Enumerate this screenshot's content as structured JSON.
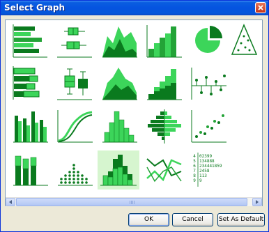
{
  "window": {
    "title": "Select Graph"
  },
  "buttons": {
    "ok": "OK",
    "cancel": "Cancel",
    "set_default": "Set As Default"
  },
  "colors": {
    "dark_green": "#0a7a1e",
    "mid_green": "#23a337",
    "light_green": "#3cd55a",
    "selected_bg": "#d6f5cf",
    "titlebar": "#0553e0"
  },
  "stem_leaf": {
    "rows": [
      {
        "stem": "4",
        "leaves": "02399"
      },
      {
        "stem": "5",
        "leaves": "134888"
      },
      {
        "stem": "6",
        "leaves": "234441859"
      },
      {
        "stem": "7",
        "leaves": "2458"
      },
      {
        "stem": "8",
        "leaves": "113"
      },
      {
        "stem": "9",
        "leaves": "9"
      }
    ]
  },
  "gallery": {
    "selected": "histogram-highlighted",
    "rows": [
      [
        "horizontal-bar",
        "box-plot",
        "area-overlay",
        "step-bars",
        "pie",
        "ternary"
      ],
      [
        "horizontal-bar-grouped",
        "box-plot-pair",
        "area-stacked",
        "step-bars-stacked",
        "dot-line"
      ],
      [
        "grouped-bars",
        "cumulative-curve",
        "histogram",
        "back-to-back-histogram",
        "scatter"
      ],
      [
        "stacked-bars",
        "dot-plot",
        "histogram-highlighted",
        "parallel-lines",
        "stem-and-leaf"
      ]
    ]
  }
}
